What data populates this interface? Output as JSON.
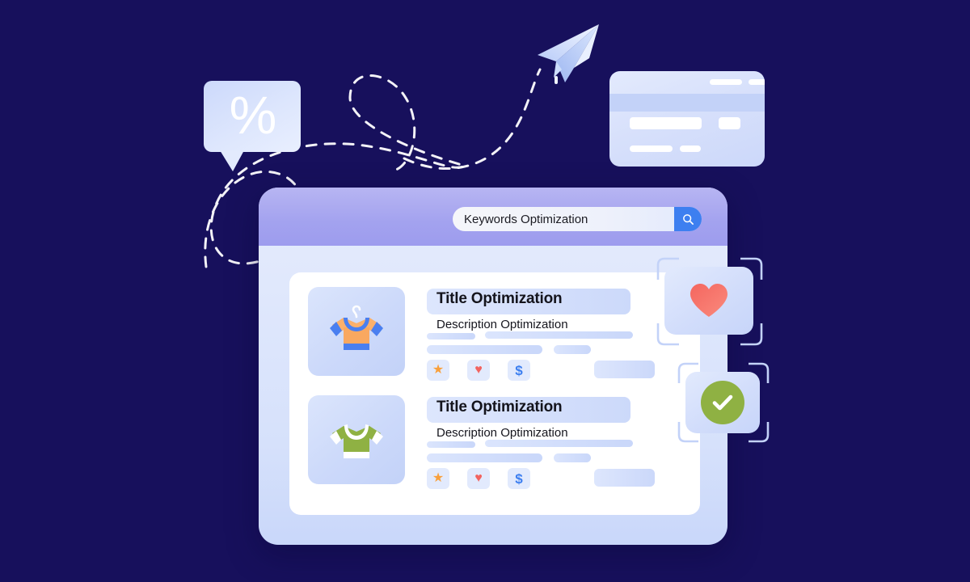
{
  "theme": {
    "background": "#17105c",
    "header_purple": "#a3a2ef",
    "accent_blue": "#3d7ff0",
    "panel_white": "#ffffff",
    "star_orange": "#f9a03c",
    "heart_red": "#f2635f",
    "dollar_blue": "#3d7ff0",
    "check_green": "#8fb143"
  },
  "browser": {
    "search": {
      "value": "Keywords Optimization",
      "placeholder": "Keywords Optimization",
      "button_icon": "search-icon"
    }
  },
  "results": [
    {
      "title": "Title Optimization",
      "description": "Description Optimization",
      "thumbnail": "tshirt-orange",
      "actions": [
        {
          "icon": "star-icon",
          "glyph": "★",
          "color": "#f9a03c"
        },
        {
          "icon": "heart-icon",
          "glyph": "♥",
          "color": "#f2635f"
        },
        {
          "icon": "dollar-icon",
          "glyph": "$",
          "color": "#3d7ff0"
        }
      ]
    },
    {
      "title": "Title Optimization",
      "description": "Description Optimization",
      "thumbnail": "tshirt-green",
      "actions": [
        {
          "icon": "star-icon",
          "glyph": "★",
          "color": "#f9a03c"
        },
        {
          "icon": "heart-icon",
          "glyph": "♥",
          "color": "#f2635f"
        },
        {
          "icon": "dollar-icon",
          "glyph": "$",
          "color": "#3d7ff0"
        }
      ]
    }
  ],
  "floating_cards": [
    {
      "name": "favorite-card",
      "icon": "heart-icon"
    },
    {
      "name": "verified-card",
      "icon": "check-circle-icon"
    }
  ],
  "decorations": {
    "speech_bubble": {
      "symbol": "%",
      "icon": "percent-bubble-icon"
    },
    "credit_card": {
      "icon": "credit-card-icon"
    },
    "paper_plane": {
      "icon": "paper-plane-icon"
    },
    "flight_path": {
      "icon": "dashed-path-icon"
    }
  }
}
